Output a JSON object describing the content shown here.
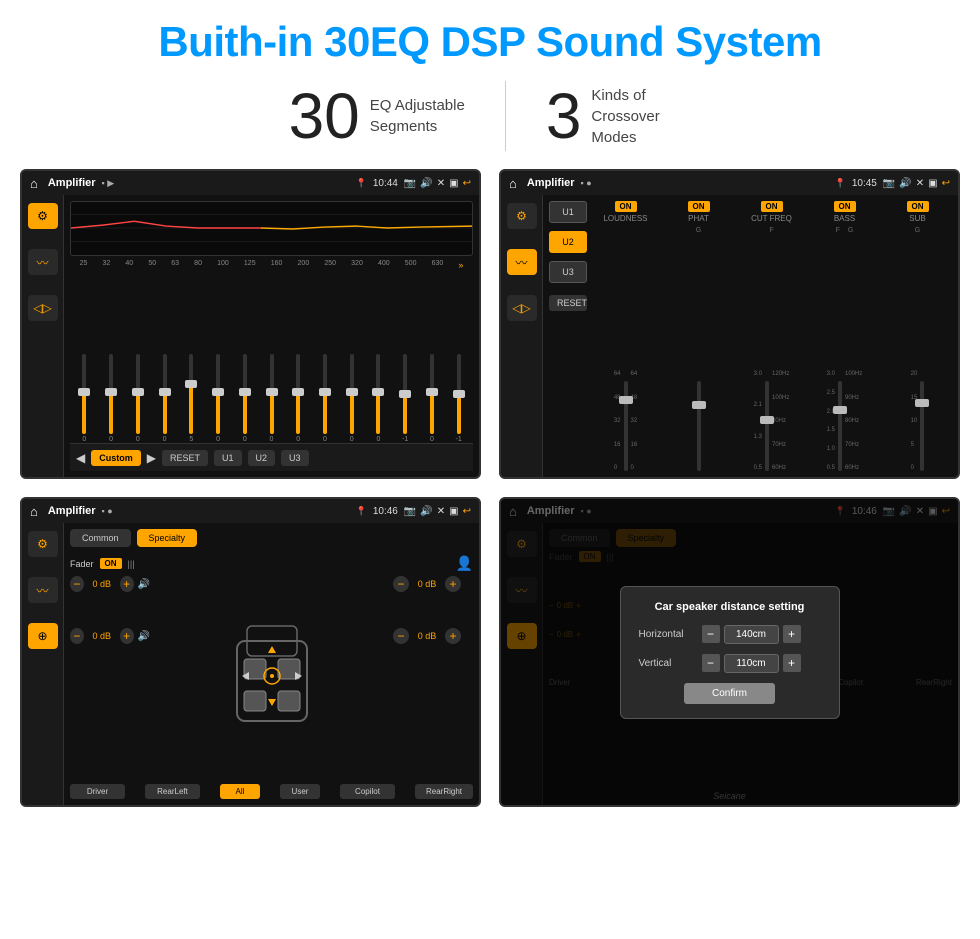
{
  "header": {
    "title": "Buith-in 30EQ DSP Sound System"
  },
  "stats": {
    "eq_number": "30",
    "eq_desc_line1": "EQ Adjustable",
    "eq_desc_line2": "Segments",
    "crossover_number": "3",
    "crossover_desc_line1": "Kinds of",
    "crossover_desc_line2": "Crossover Modes"
  },
  "screen1": {
    "title": "Amplifier",
    "time": "10:44",
    "eq_bands": [
      "25",
      "32",
      "40",
      "50",
      "63",
      "80",
      "100",
      "125",
      "160",
      "200",
      "250",
      "320",
      "400",
      "500",
      "630"
    ],
    "eq_values": [
      "0",
      "0",
      "0",
      "0",
      "5",
      "0",
      "0",
      "0",
      "0",
      "0",
      "0",
      "0",
      "-1",
      "0",
      "-1"
    ],
    "bottom_buttons": [
      "Custom",
      "RESET",
      "U1",
      "U2",
      "U3"
    ]
  },
  "screen2": {
    "title": "Amplifier",
    "time": "10:45",
    "preset_buttons": [
      "U1",
      "U2",
      "U3"
    ],
    "channels": [
      "LOUDNESS",
      "PHAT",
      "CUT FREQ",
      "BASS",
      "SUB"
    ],
    "reset_label": "RESET"
  },
  "screen3": {
    "title": "Amplifier",
    "time": "10:46",
    "tabs": [
      "Common",
      "Specialty"
    ],
    "fader_label": "Fader",
    "fader_state": "ON",
    "vol_rows": [
      {
        "label": "0 dB"
      },
      {
        "label": "0 dB"
      },
      {
        "label": "0 dB"
      },
      {
        "label": "0 dB"
      }
    ],
    "speaker_buttons": [
      "Driver",
      "RearLeft",
      "All",
      "User",
      "Copilot",
      "RearRight"
    ]
  },
  "screen4": {
    "title": "Amplifier",
    "time": "10:46",
    "dialog": {
      "title": "Car speaker distance setting",
      "horizontal_label": "Horizontal",
      "horizontal_value": "140cm",
      "vertical_label": "Vertical",
      "vertical_value": "110cm",
      "confirm_label": "Confirm"
    }
  },
  "watermark": "Seicane"
}
